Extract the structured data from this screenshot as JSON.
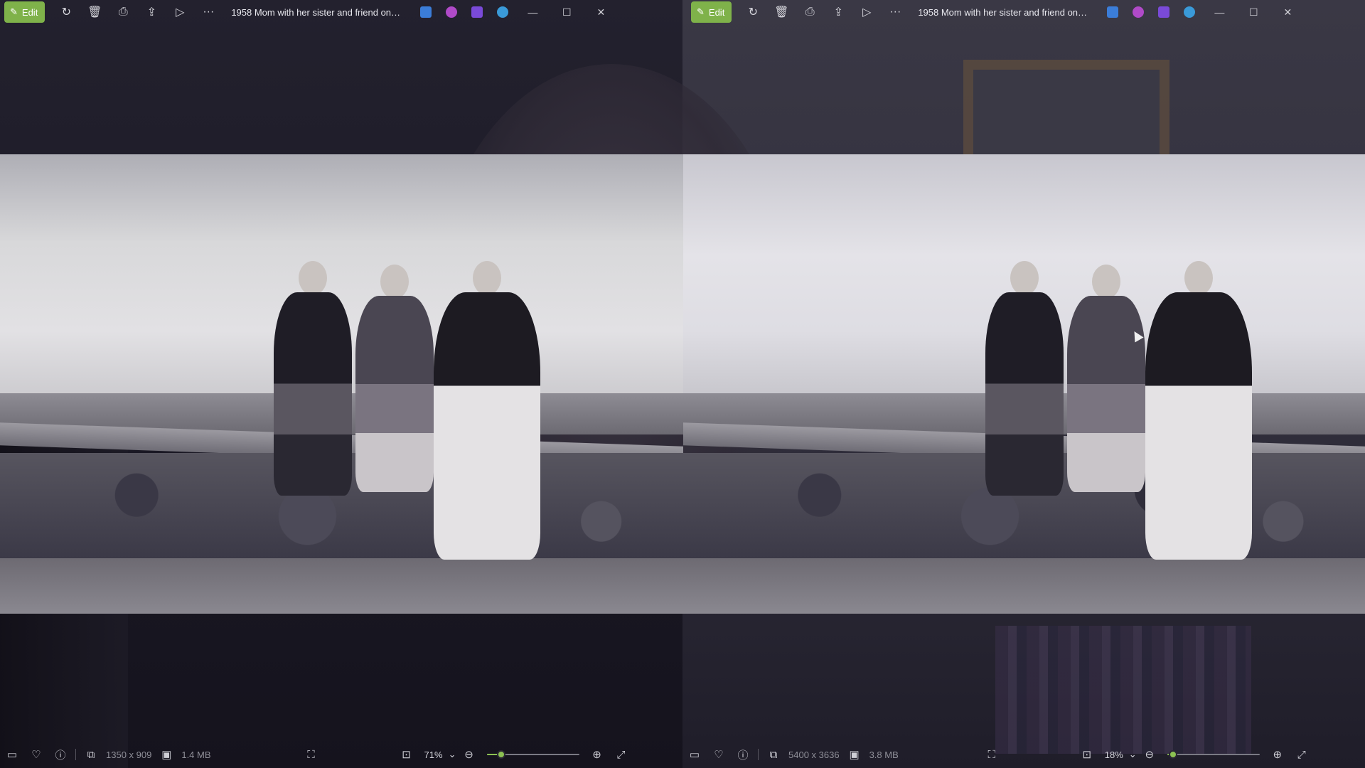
{
  "windows": [
    {
      "id": "left",
      "toolbar": {
        "edit_label": "Edit",
        "title": "1958 Mom with her sister and friend on R...",
        "more_label": "···"
      },
      "status": {
        "dimensions": "1350 x 909",
        "file_size": "1.4 MB",
        "zoom": "71%",
        "zoom_fraction": 0.12
      }
    },
    {
      "id": "right",
      "toolbar": {
        "edit_label": "Edit",
        "title": "1958 Mom with her sister and friend on R...",
        "more_label": "···"
      },
      "status": {
        "dimensions": "5400 x 3636",
        "file_size": "3.8 MB",
        "zoom": "18%",
        "zoom_fraction": 0.02
      }
    }
  ],
  "icons": {
    "edit": "✎",
    "rotate": "↻",
    "delete": "🗑",
    "print": "⎙",
    "share": "⇪",
    "slideshow": "▷",
    "minimize": "—",
    "maximize": "☐",
    "close": "✕",
    "filmstrip": "▭",
    "favorite": "♡",
    "info": "ⓘ",
    "dimensions": "⧉",
    "filesize": "▣",
    "fit": "⛶",
    "actual-size": "⊡",
    "chevron": "⌄",
    "zoom-out": "⊖",
    "zoom-in": "⊕",
    "fullscreen": "⤢"
  },
  "app_colors": {
    "edit_accent": "#7fb24a",
    "slider_accent": "#8cc152",
    "app1": "#3b7dd8",
    "app2": "#b04ac8",
    "app3": "#7a4ad8",
    "app4": "#3a9ad8"
  }
}
